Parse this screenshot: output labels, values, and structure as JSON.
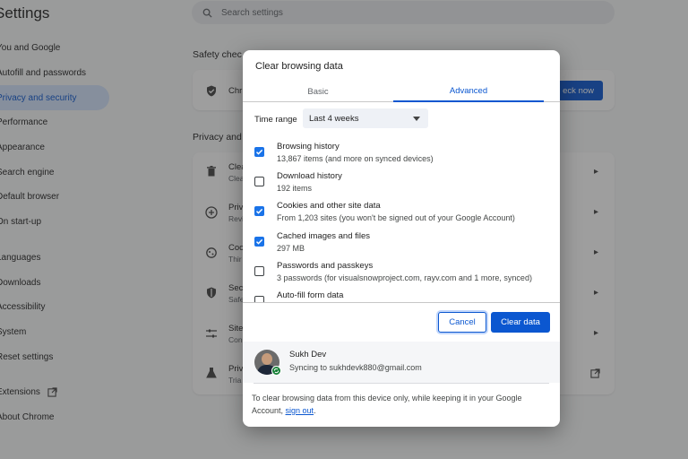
{
  "settings": {
    "title": "Settings",
    "search_placeholder": "Search settings",
    "nav": [
      {
        "label": "You and Google"
      },
      {
        "label": "Autofill and passwords"
      },
      {
        "label": "Privacy and security"
      },
      {
        "label": "Performance"
      },
      {
        "label": "Appearance"
      },
      {
        "label": "Search engine"
      },
      {
        "label": "Default browser"
      },
      {
        "label": "On start-up"
      },
      {
        "label": "Languages"
      },
      {
        "label": "Downloads"
      },
      {
        "label": "Accessibility"
      },
      {
        "label": "System"
      },
      {
        "label": "Reset settings"
      },
      {
        "label": "Extensions"
      },
      {
        "label": "About Chrome"
      }
    ],
    "safety_check": {
      "title": "Safety chec",
      "row_title": "Chr",
      "button": "eck now"
    },
    "privacy": {
      "title": "Privacy and",
      "rows": [
        {
          "title": "Clea",
          "sub": "Clea",
          "icon": "trash-icon"
        },
        {
          "title": "Priv",
          "sub": "Revi",
          "icon": "privacy-guide-icon"
        },
        {
          "title": "Coo",
          "sub": "Thir",
          "icon": "cookie-icon"
        },
        {
          "title": "Sec",
          "sub": "Safe",
          "icon": "shield-icon"
        },
        {
          "title": "Site",
          "sub": "Con",
          "icon": "sliders-icon"
        },
        {
          "title": "Priv",
          "sub": "Tria",
          "icon": "flask-icon"
        }
      ]
    }
  },
  "dialog": {
    "title": "Clear browsing data",
    "tabs": {
      "basic": "Basic",
      "advanced": "Advanced"
    },
    "time_range": {
      "label": "Time range",
      "value": "Last 4 weeks"
    },
    "items": [
      {
        "title": "Browsing history",
        "sub": "13,867 items (and more on synced devices)",
        "checked": true
      },
      {
        "title": "Download history",
        "sub": "192 items",
        "checked": false
      },
      {
        "title": "Cookies and other site data",
        "sub": "From 1,203 sites (you won't be signed out of your Google Account)",
        "checked": true
      },
      {
        "title": "Cached images and files",
        "sub": "297 MB",
        "checked": true
      },
      {
        "title": "Passwords and passkeys",
        "sub": "3 passwords (for visualsnowproject.com, rayv.com and 1 more, synced)",
        "checked": false
      },
      {
        "title": "Auto-fill form data",
        "sub": "",
        "checked": false
      }
    ],
    "cancel_label": "Cancel",
    "clear_label": "Clear data",
    "account": {
      "name": "Sukh Dev",
      "sync_text": "Syncing to sukhdevk880@gmail.com"
    },
    "footnote_text": "To clear browsing data from this device only, while keeping it in your Google Account, ",
    "sign_out_link": "sign out",
    "footnote_end": ".",
    "accent_color": "#0b57d0"
  }
}
